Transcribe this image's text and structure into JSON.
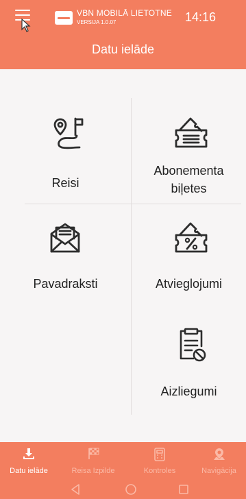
{
  "header": {
    "app_name": "VBN MOBILĀ LIETOTNE",
    "app_version": "VERSIJA 1.0.07",
    "clock": "14:16",
    "title": "Datu ielāde"
  },
  "tiles": {
    "trips": "Reisi",
    "subscription_line1": "Abonementa",
    "subscription_line2": "biļetes",
    "waybills": "Pavadraksti",
    "discounts": "Atvieglojumi",
    "bans": "Aizliegumi"
  },
  "bottom_nav": {
    "data_load": "Datu ielāde",
    "trip_execution": "Reisa Izpilde",
    "controls": "Kontroles",
    "navigation": "Navigācija"
  },
  "colors": {
    "brand": "#f37e5f",
    "background": "#f7f5f5",
    "divider": "#e1dcdc",
    "inactive_nav": "#fbb9a6"
  }
}
